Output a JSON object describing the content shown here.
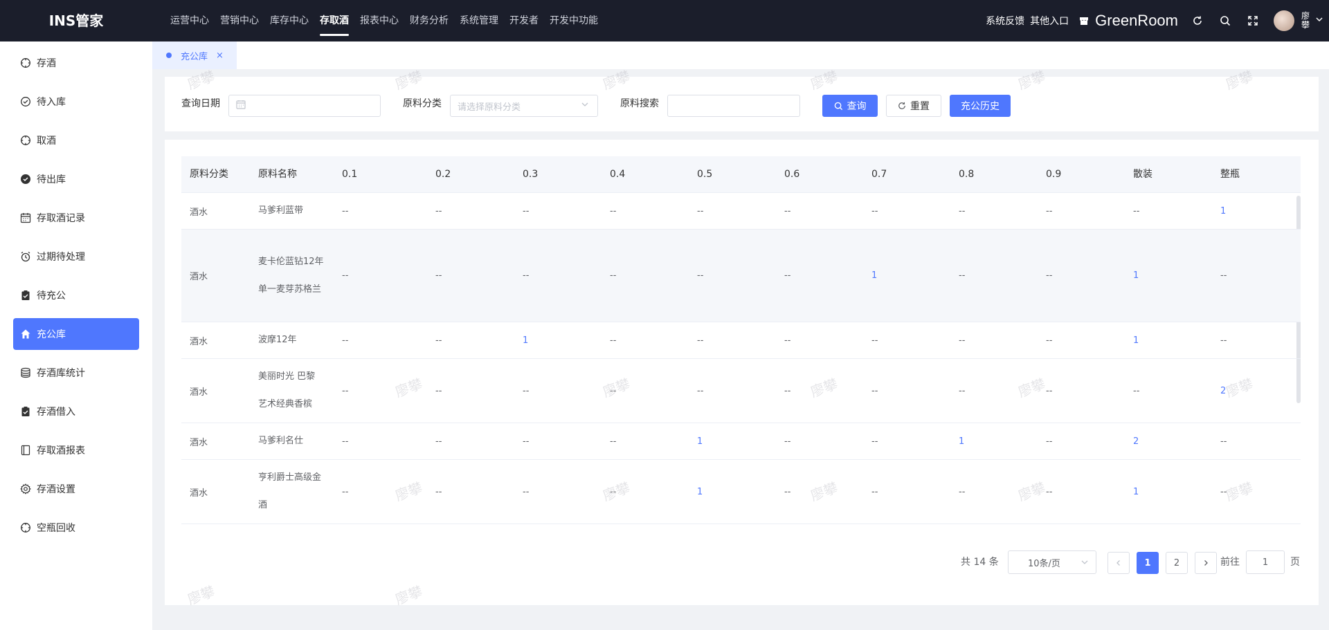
{
  "app": {
    "logo": "INS管家"
  },
  "topnav": [
    {
      "label": "运营中心"
    },
    {
      "label": "营销中心"
    },
    {
      "label": "库存中心"
    },
    {
      "label": "存取酒",
      "active": true
    },
    {
      "label": "报表中心"
    },
    {
      "label": "财务分析"
    },
    {
      "label": "系统管理"
    },
    {
      "label": "开发者"
    },
    {
      "label": "开发中功能"
    }
  ],
  "topright": {
    "feedback": "系统反馈",
    "other_entry": "其他入口",
    "store_name": "GreenRoom",
    "username": "廖攀"
  },
  "sidebar": {
    "items": [
      {
        "label": "存酒",
        "icon": "compass-icon"
      },
      {
        "label": "待入库",
        "icon": "check-circle-icon"
      },
      {
        "label": "取酒",
        "icon": "compass-icon"
      },
      {
        "label": "待出库",
        "icon": "check-circle-filled-icon"
      },
      {
        "label": "存取酒记录",
        "icon": "calendar-icon"
      },
      {
        "label": "过期待处理",
        "icon": "alarm-icon"
      },
      {
        "label": "待充公",
        "icon": "clipboard-icon"
      },
      {
        "label": "充公库",
        "icon": "home-icon",
        "active": true
      },
      {
        "label": "存酒库统计",
        "icon": "database-icon"
      },
      {
        "label": "存酒借入",
        "icon": "clipboard-icon"
      },
      {
        "label": "存取酒报表",
        "icon": "report-icon"
      },
      {
        "label": "存酒设置",
        "icon": "gear-icon"
      },
      {
        "label": "空瓶回收",
        "icon": "compass-icon"
      }
    ]
  },
  "tabs": [
    {
      "label": "充公库",
      "close": "×"
    }
  ],
  "filters": {
    "date_label": "查询日期",
    "category_label": "原料分类",
    "category_placeholder": "请选择原料分类",
    "search_label": "原料搜索",
    "search_value": "",
    "query_button": "查询",
    "reset_button": "重置",
    "history_button": "充公历史"
  },
  "table": {
    "columns": [
      "原料分类",
      "原料名称",
      "0.1",
      "0.2",
      "0.3",
      "0.4",
      "0.5",
      "0.6",
      "0.7",
      "0.8",
      "0.9",
      "散装",
      "整瓶"
    ],
    "rows": [
      {
        "cells": [
          "酒水",
          "马爹利蓝带",
          "--",
          "--",
          "--",
          "--",
          "--",
          "--",
          "--",
          "--",
          "--",
          "--",
          "1"
        ]
      },
      {
        "cells": [
          "酒水",
          "麦卡伦蓝钻12年单一麦芽苏格兰",
          "--",
          "--",
          "--",
          "--",
          "--",
          "--",
          "1",
          "--",
          "--",
          "1",
          "--"
        ]
      },
      {
        "cells": [
          "酒水",
          "波摩12年",
          "--",
          "--",
          "1",
          "--",
          "--",
          "--",
          "--",
          "--",
          "--",
          "1",
          "--"
        ]
      },
      {
        "cells": [
          "酒水",
          "美丽时光 巴黎艺术经典香槟",
          "--",
          "--",
          "--",
          "--",
          "--",
          "--",
          "--",
          "--",
          "--",
          "--",
          "2"
        ]
      },
      {
        "cells": [
          "酒水",
          "马爹利名仕",
          "--",
          "--",
          "--",
          "--",
          "1",
          "--",
          "--",
          "1",
          "--",
          "2",
          "--"
        ]
      },
      {
        "cells": [
          "酒水",
          "亨利爵士高级金酒",
          "--",
          "--",
          "--",
          "--",
          "1",
          "--",
          "--",
          "--",
          "--",
          "1",
          "--"
        ]
      }
    ]
  },
  "pagination": {
    "total": "共 14 条",
    "page_size": "10条/页",
    "pages": [
      "1",
      "2"
    ],
    "current": "1",
    "goto_label": "前往",
    "goto_value": "1",
    "page_suffix": "页"
  },
  "watermark": "廖攀",
  "colors": {
    "primary": "#4f77fe",
    "topbar": "#1b1e2b"
  }
}
